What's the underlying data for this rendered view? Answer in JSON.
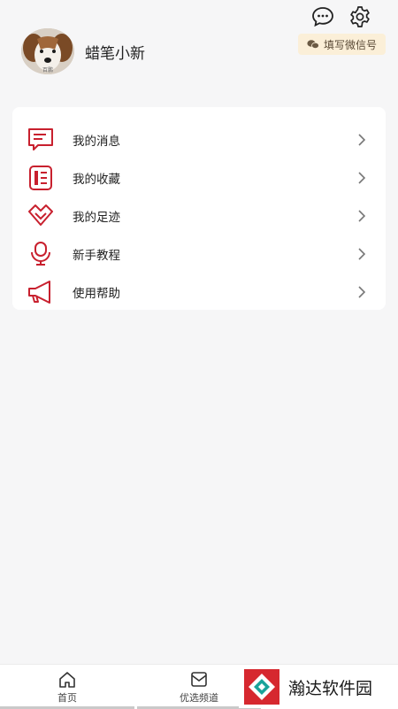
{
  "header": {
    "username": "蜡笔小新",
    "avatar_caption": "百鹏",
    "wechat_button_label": "填写微信号",
    "icons": [
      "chat-bubble-icon",
      "settings-gear-icon"
    ]
  },
  "menu": {
    "items": [
      {
        "label": "我的消息",
        "icon": "message-icon"
      },
      {
        "label": "我的收藏",
        "icon": "favorites-icon"
      },
      {
        "label": "我的足迹",
        "icon": "footprint-icon"
      },
      {
        "label": "新手教程",
        "icon": "tutorial-microphone-icon"
      },
      {
        "label": "使用帮助",
        "icon": "megaphone-icon"
      }
    ]
  },
  "tabbar": {
    "tabs": [
      {
        "label": "首页",
        "icon": "home-icon"
      },
      {
        "label": "优选频道",
        "icon": "channel-icon"
      }
    ]
  },
  "watermark": {
    "text": "瀚达软件园"
  },
  "colors": {
    "accent": "#c8202e",
    "background": "#f6f6f7",
    "card": "#ffffff",
    "badge_bg": "#fbefd8"
  }
}
